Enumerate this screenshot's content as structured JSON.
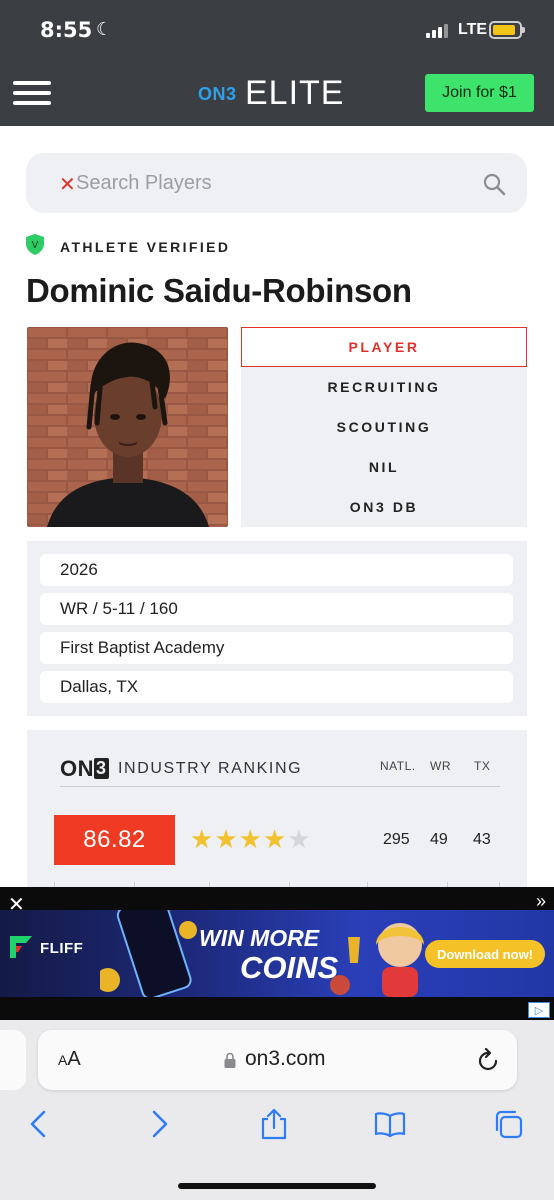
{
  "status_bar": {
    "time": "8:55",
    "network": "LTE"
  },
  "nav": {
    "logo_on3": "ON3",
    "logo_elite": "ELITE",
    "join_label": "Join for $1"
  },
  "search": {
    "placeholder": "Search Players"
  },
  "profile": {
    "verified_label": "ATHLETE VERIFIED",
    "name": "Dominic Saidu-Robinson"
  },
  "tabs": [
    {
      "label": "PLAYER",
      "active": true
    },
    {
      "label": "RECRUITING",
      "active": false
    },
    {
      "label": "SCOUTING",
      "active": false
    },
    {
      "label": "NIL",
      "active": false
    },
    {
      "label": "ON3 DB",
      "active": false
    }
  ],
  "info": {
    "class_year": "2026",
    "position_size": "WR / 5-11 / 160",
    "school": "First Baptist Academy",
    "hometown": "Dallas, TX"
  },
  "ranking": {
    "logo": "ON",
    "logo_three": "3",
    "title": "INDUSTRY RANKING",
    "columns": [
      "NATL.",
      "WR",
      "TX"
    ],
    "score": "86.82",
    "stars": 4,
    "stars_max": 5,
    "values": [
      "295",
      "49",
      "43"
    ],
    "star_color": "#f2c12e"
  },
  "ad": {
    "brand": "FLIFF",
    "headline_1": "WIN MORE",
    "headline_2": "COINS",
    "cta": "Download now!"
  },
  "browser": {
    "text_size_label": "AA",
    "domain": "on3.com"
  },
  "colors": {
    "accent": "#e0322b",
    "score_bg": "#ef3b24",
    "join_bg": "#3ee36b",
    "header_bg": "#3b3e43",
    "safari_blue": "#2f7cf6"
  }
}
